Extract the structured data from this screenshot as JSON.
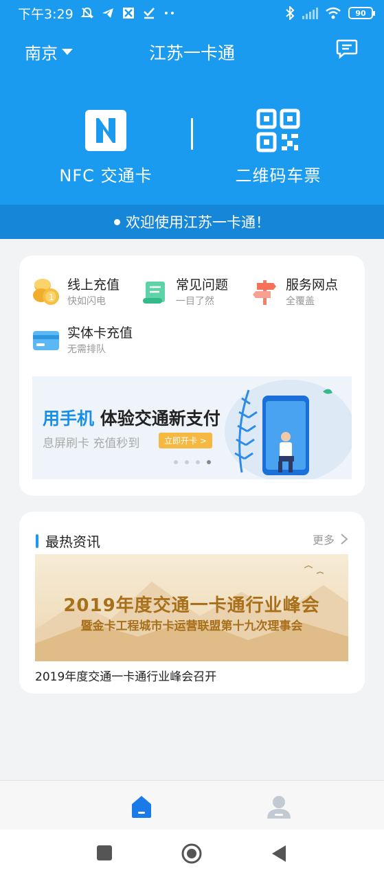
{
  "status_bar": {
    "time": "下午3:29",
    "battery": "90",
    "icons": [
      "mute-bell-icon",
      "telegram-icon",
      "app-icon",
      "check-icon",
      "more-dots-icon",
      "bluetooth-icon",
      "signal-icon",
      "wifi-icon",
      "battery-icon"
    ]
  },
  "header": {
    "city": "南京",
    "title": "江苏一卡通",
    "message_icon": "message-icon"
  },
  "quick_entries": {
    "nfc_label": "NFC 交通卡",
    "qr_label": "二维码车票"
  },
  "welcome": {
    "text": "欢迎使用江苏一卡通！"
  },
  "services": [
    {
      "title": "线上充值",
      "subtitle": "快如闪电",
      "icon": "coins-icon"
    },
    {
      "title": "常见问题",
      "subtitle": "一目了然",
      "icon": "scroll-icon"
    },
    {
      "title": "服务网点",
      "subtitle": "全覆盖",
      "icon": "signpost-icon"
    },
    {
      "title": "实体卡充值",
      "subtitle": "无需排队",
      "icon": "card-icon"
    }
  ],
  "banner": {
    "headline_accent": "用手机",
    "headline_rest": " 体验交通新支付",
    "subtitle": "息屏刷卡 充值秒到",
    "cta": "立即开卡 >",
    "slide_count": 4,
    "active_slide": 4
  },
  "news": {
    "section_title": "最热资讯",
    "more_label": "更多",
    "image_title": "2019年度交通一卡通行业峰会",
    "image_subtitle": "暨金卡工程城市卡运营联盟第十九次理事会",
    "caption": "2019年度交通一卡通行业峰会召开"
  },
  "tabbar": {
    "tabs": [
      {
        "icon": "home-icon",
        "active": true
      },
      {
        "icon": "person-icon",
        "active": false
      }
    ]
  },
  "colors": {
    "brand": "#1a9bf0",
    "welcome_bar": "#1686d9",
    "background": "#f2f3f5"
  }
}
